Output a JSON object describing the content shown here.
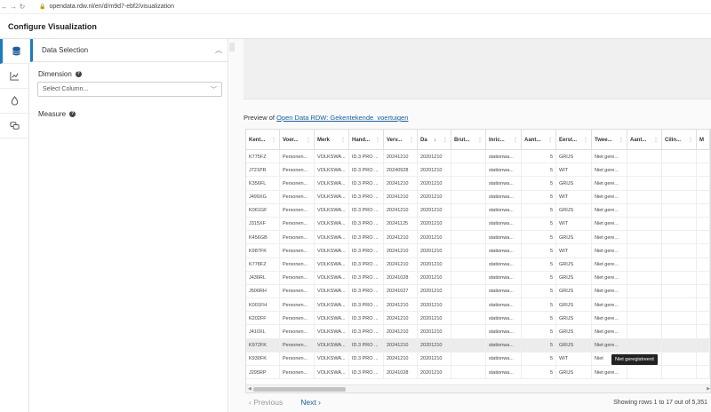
{
  "browser": {
    "url": "opendata.rdw.nl/en/d/m9d7-ebf2/visualization"
  },
  "app": {
    "title": "Configure Visualization"
  },
  "rail": {
    "icons": [
      "database-icon",
      "chart-icon",
      "droplet-icon",
      "chat-icon"
    ]
  },
  "panel": {
    "title": "Data Selection",
    "dimension_label": "Dimension",
    "dimension_placeholder": "Select Column...",
    "measure_label": "Measure"
  },
  "preview": {
    "prefix": "Preview of ",
    "link": "Open Data RDW: Gekentekende_voertuigen"
  },
  "table": {
    "columns": [
      "Kent...",
      "Voer...",
      "Merk",
      "Hand...",
      "Verv...",
      "Da",
      "Brut...",
      "Inric...",
      "Aant...",
      "Eerst...",
      "Twee...",
      "Aant...",
      "Cilin...",
      "M"
    ],
    "rows": [
      [
        "K775FZ",
        "Personen...",
        "VOLKSWA...",
        "ID.3 PRO ...",
        "20241210",
        "20201210",
        "",
        "stationwa...",
        "5",
        "GRIJS",
        "Niet gere...",
        "",
        "",
        ""
      ],
      [
        "J721PR",
        "Personen...",
        "VOLKSWA...",
        "ID.3 PRO ...",
        "20240928",
        "20201210",
        "",
        "stationwa...",
        "5",
        "WIT",
        "Niet gere...",
        "",
        "",
        ""
      ],
      [
        "K356FL",
        "Personen...",
        "VOLKSWA...",
        "ID.3 PRO ...",
        "20241210",
        "20201210",
        "",
        "stationwa...",
        "5",
        "GRIJS",
        "Niet gere...",
        "",
        "",
        ""
      ],
      [
        "J499XG",
        "Personen...",
        "VOLKSWA...",
        "ID.3 PRO ...",
        "20241210",
        "20201210",
        "",
        "stationwa...",
        "5",
        "WIT",
        "Niet gere...",
        "",
        "",
        ""
      ],
      [
        "K061GF",
        "Personen...",
        "VOLKSWA...",
        "ID.3 PRO ...",
        "20241210",
        "20201210",
        "",
        "stationwa...",
        "5",
        "GRIJS",
        "Niet gere...",
        "",
        "",
        ""
      ],
      [
        "J315XF",
        "Personen...",
        "VOLKSWA...",
        "ID.3 PRO ...",
        "20241125",
        "20201210",
        "",
        "stationwa...",
        "5",
        "WIT",
        "Niet gere...",
        "",
        "",
        ""
      ],
      [
        "K456GB",
        "Personen...",
        "VOLKSWA...",
        "ID.3 PRO ...",
        "20241210",
        "20201210",
        "",
        "stationwa...",
        "5",
        "GRIJS",
        "Niet gere...",
        "",
        "",
        ""
      ],
      [
        "K987FK",
        "Personen...",
        "VOLKSWA...",
        "ID.3 PRO ...",
        "20241210",
        "20201210",
        "",
        "stationwa...",
        "5",
        "WIT",
        "Niet gere...",
        "",
        "",
        ""
      ],
      [
        "K778FZ",
        "Personen...",
        "VOLKSWA...",
        "ID.3 PRO ...",
        "20241210",
        "20201210",
        "",
        "stationwa...",
        "5",
        "GRIJS",
        "Niet gere...",
        "",
        "",
        ""
      ],
      [
        "J436RL",
        "Personen...",
        "VOLKSWA...",
        "ID.3 PRO ...",
        "20241028",
        "20201210",
        "",
        "stationwa...",
        "5",
        "GRIJS",
        "Niet gere...",
        "",
        "",
        ""
      ],
      [
        "J506RH",
        "Personen...",
        "VOLKSWA...",
        "ID.3 PRO ...",
        "20241027",
        "20201210",
        "",
        "stationwa...",
        "5",
        "GRIJS",
        "Niet gere...",
        "",
        "",
        ""
      ],
      [
        "K001FH",
        "Personen...",
        "VOLKSWA...",
        "ID.3 PRO ...",
        "20241210",
        "20201210",
        "",
        "stationwa...",
        "5",
        "GRIJS",
        "Niet gere...",
        "",
        "",
        ""
      ],
      [
        "K202FF",
        "Personen...",
        "VOLKSWA...",
        "ID.3 PRO ...",
        "20241210",
        "20201210",
        "",
        "stationwa...",
        "5",
        "GRIJS",
        "Niet gere...",
        "",
        "",
        ""
      ],
      [
        "J410XL",
        "Personen...",
        "VOLKSWA...",
        "ID.3 PRO ...",
        "20241210",
        "20201210",
        "",
        "stationwa...",
        "5",
        "GRIJS",
        "Niet gere...",
        "",
        "",
        ""
      ],
      [
        "K972FK",
        "Personen...",
        "VOLKSWA...",
        "ID.3 PRO ...",
        "20241210",
        "20201210",
        "",
        "stationwa...",
        "5",
        "GRIJS",
        "Niet gere...",
        "",
        "",
        ""
      ],
      [
        "K930FK",
        "Personen...",
        "VOLKSWA...",
        "ID.3 PRO ...",
        "20241210",
        "20201210",
        "",
        "stationwa...",
        "5",
        "WIT",
        "Niet",
        "",
        "",
        ""
      ],
      [
        "J295RP",
        "Personen...",
        "VOLKSWA...",
        "ID.3 PRO ...",
        "20241028",
        "20201210",
        "",
        "stationwa...",
        "5",
        "GRIJS",
        "Niet gere...",
        "",
        "",
        ""
      ]
    ],
    "highlighted_row": 14,
    "tooltip": "Niet geregistreerd"
  },
  "pager": {
    "prev": "Previous",
    "next": "Next",
    "info": "Showing rows 1 to 17 out of 5,351"
  },
  "colors": {
    "accent": "#1a7bbf",
    "link": "#1a5f9c"
  }
}
